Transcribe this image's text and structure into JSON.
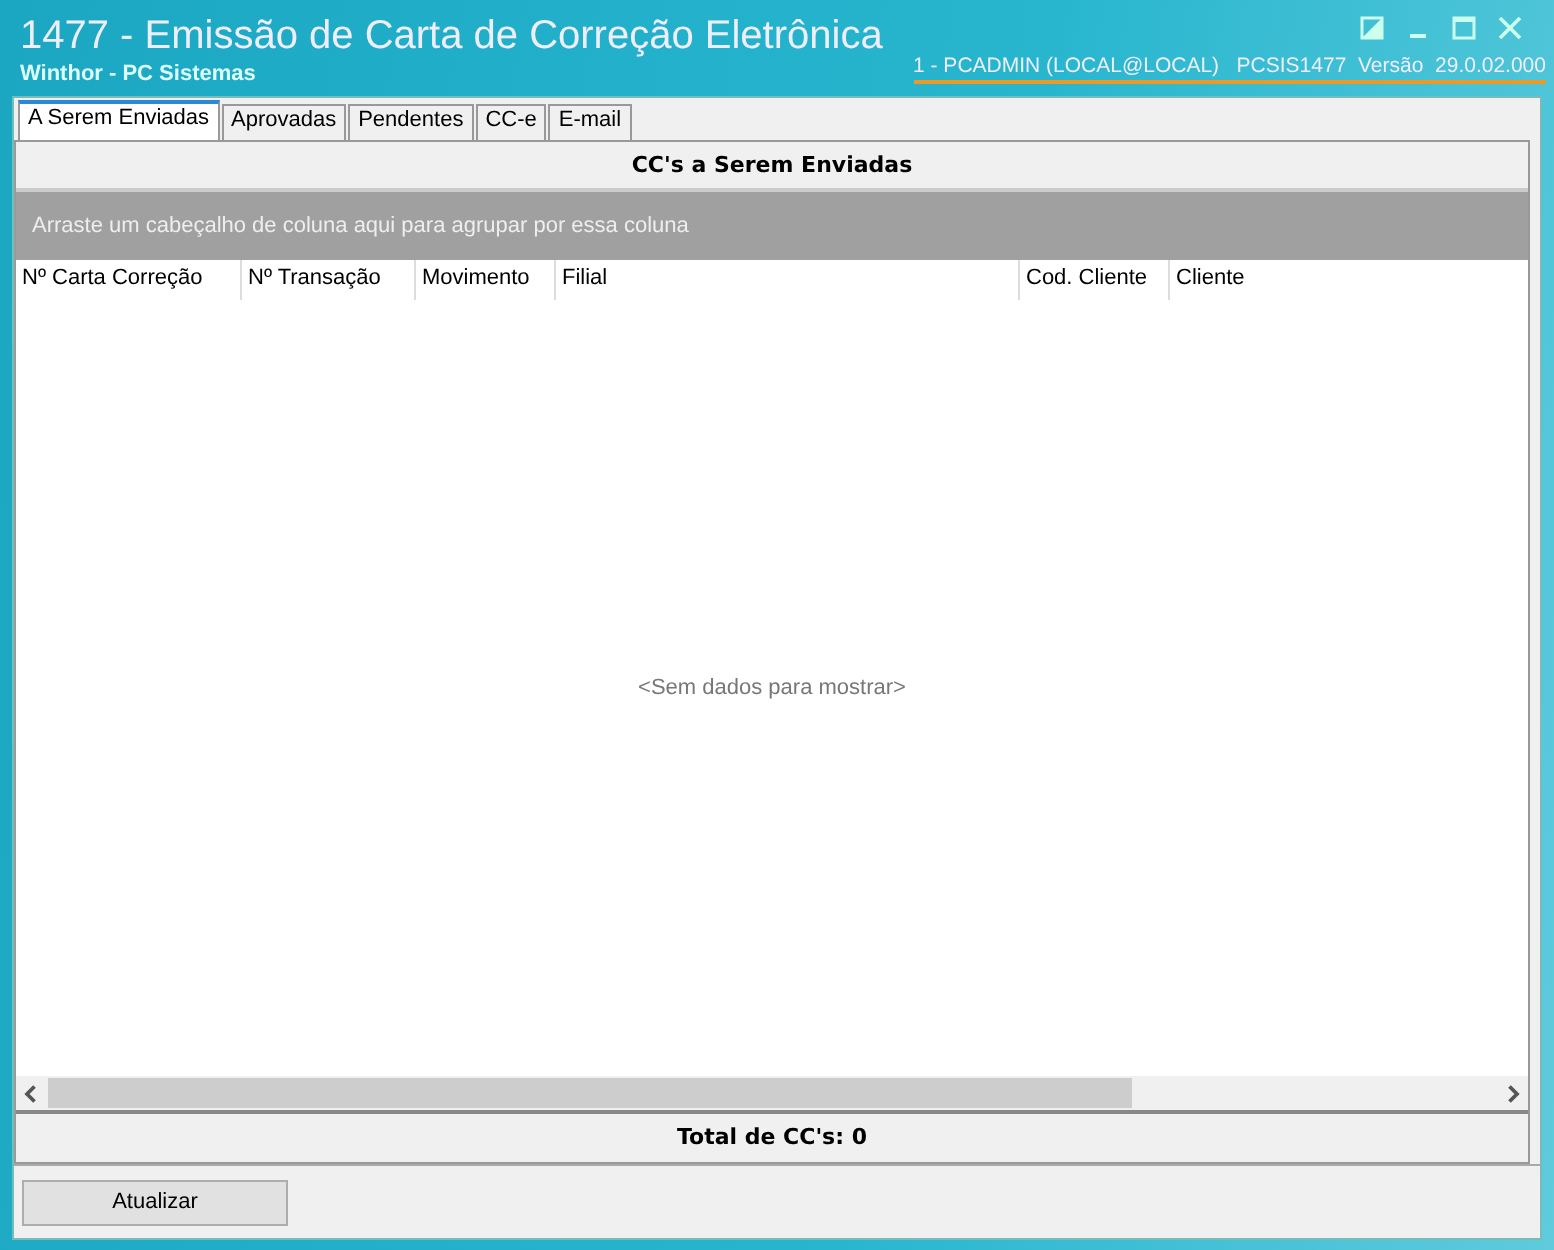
{
  "window": {
    "title": "1477 - Emissão de Carta de Correção Eletrônica",
    "subtitle": "Winthor - PC Sistemas",
    "session": "1 - PCADMIN (LOCAL@LOCAL)   PCSIS1477  Versão  29.0.02.000"
  },
  "tabs": [
    {
      "label": "A Serem Enviadas",
      "selected": true
    },
    {
      "label": "Aprovadas",
      "selected": false
    },
    {
      "label": "Pendentes",
      "selected": false
    },
    {
      "label": "CC-e",
      "selected": false
    },
    {
      "label": "E-mail",
      "selected": false
    }
  ],
  "grid": {
    "title": "CC's a Serem Enviadas",
    "group_hint": "Arraste um cabeçalho de coluna aqui para agrupar por essa coluna",
    "columns": [
      "Nº Carta Correção",
      "Nº Transação",
      "Movimento",
      "Filial",
      "Cod. Cliente",
      "Cliente"
    ],
    "empty_text": "<Sem dados para mostrar>",
    "total": "Total de CC's: 0"
  },
  "buttons": [
    "Atualizar"
  ]
}
